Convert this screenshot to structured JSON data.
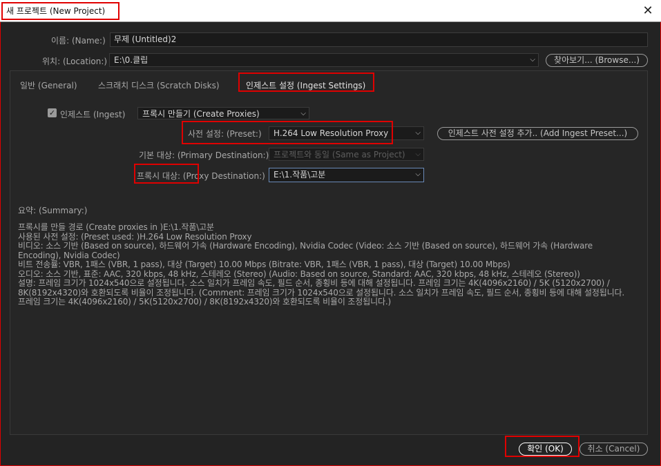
{
  "window": {
    "title": "새 프로젝트 (New Project)",
    "close_glyph": "✕"
  },
  "name_row": {
    "label": "이름: (Name:)",
    "value": "무제 (Untitled)2"
  },
  "location_row": {
    "label": "위치: (Location:)",
    "value": "E:\\0.클립",
    "browse_label": "찾아보기... (Browse...)"
  },
  "tabs": [
    {
      "label": "일반 (General)"
    },
    {
      "label": "스크래치 디스크 (Scratch Disks)"
    },
    {
      "label": "인제스트 설정 (Ingest Settings)"
    }
  ],
  "ingest": {
    "checkbox_label": "인제스트 (Ingest)",
    "checked": true,
    "mode_value": "프록시 만들기 (Create Proxies)",
    "preset_label": "사전 설정: (Preset:)",
    "preset_value": "H.264 Low Resolution Proxy",
    "add_preset_label": "인제스트 사전 설정 추가.. (Add Ingest Preset...)",
    "primary_label": "기본 대상: (Primary Destination:)",
    "primary_value": "프로젝트와 동일 (Same as Project)",
    "proxy_label": "프록시 대상: (Proxy Destination:)",
    "proxy_value": "E:\\1.작품\\고분"
  },
  "summary": {
    "title": "요약: (Summary:)",
    "lines": [
      "프록시를 만들 경로  (Create proxies in )E:\\1.작품\\고분",
      "사용된 사전 설정:  (Preset used: )H.264 Low Resolution Proxy",
      "비디오: 소스 기반 (Based on source), 하드웨어 가속 (Hardware Encoding), Nvidia Codec (Video: 소스 기반 (Based on source), 하드웨어 가속 (Hardware Encoding), Nvidia Codec)",
      "비트 전송률: VBR, 1패스 (VBR, 1 pass), 대상 (Target) 10.00 Mbps (Bitrate: VBR, 1패스 (VBR, 1 pass), 대상 (Target) 10.00 Mbps)",
      "오디오: 소스 기반, 표준: AAC, 320 kbps, 48 kHz, 스테레오 (Stereo) (Audio: Based on source, Standard: AAC, 320 kbps, 48 kHz, 스테레오 (Stereo))",
      "설명: 프레임 크기가 1024x540으로 설정됩니다. 소스 일치가 프레임 속도, 필드 순서, 종횡비 등에 대해 설정됩니다. 프레임 크기는 4K(4096x2160) / 5K (5120x2700) / 8K(8192x4320)와 호환되도록 비율이 조정됩니다. (Comment: 프레임 크기가 1024x540으로 설정됩니다. 소스 일치가 프레임 속도, 필드 순서, 종횡비 등에 대해 설정됩니다. 프레임 크기는 4K(4096x2160) / 5K(5120x2700) / 8K(8192x4320)와 호환되도록 비율이 조정됩니다.)"
    ]
  },
  "buttons": {
    "ok_label": "확인 (OK)",
    "cancel_label": "취소 (Cancel)"
  },
  "icons": {
    "checkmark": "✓",
    "chevron": "⌵"
  },
  "colors": {
    "highlight": "#e00000",
    "background": "#232323",
    "panel": "#262626"
  }
}
